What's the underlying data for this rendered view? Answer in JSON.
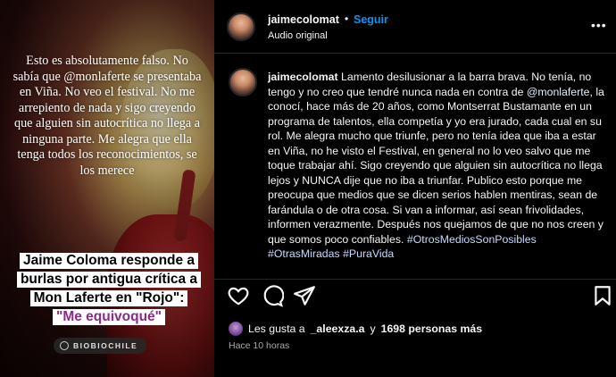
{
  "media": {
    "quote": "Esto es absolutamente falso. No sabía que @monlaferte se presentaba en Viña. No veo el festival. No me arrepiento de nada y sigo creyendo que alguien sin autocrítica no llega a ninguna parte. Me alegra que ella tenga todos los reconocimientos, se los merece",
    "headline_lines": [
      "Jaime Coloma responde a",
      "burlas por antigua crítica a",
      "Mon Laferte en \"Rojo\":"
    ],
    "headline_accent": "\"Me equivoqué\"",
    "brand": "BIOBIOCHILE"
  },
  "post": {
    "username": "jaimecolomat",
    "separator": "•",
    "follow_label": "Seguir",
    "audio": "Audio original",
    "more_label": "•••"
  },
  "comment": {
    "username": "jaimecolomat",
    "text_1": " Lamento desilusionar a la barra brava. No tenía, no tengo y no creo que tendré nunca nada en contra de ",
    "mention": "@monlaferte",
    "text_2": ", la conocí, hace más de 20 años, como Montserrat Bustamante en un programa de talentos, ella competía y yo era jurado, cada cual en su rol. Me alegra mucho que triunfe, pero no tenía idea que iba a estar en Viña, no he visto el Festival, en general no lo veo salvo que me toque trabajar ahí. Sigo creyendo que alguien sin autocrítica no llega lejos y NUNCA dije que no iba a triunfar. Publico esto porque me preocupa que medios que se dicen serios hablen mentiras, sean de farándula o de otra cosa. Si van a informar, así sean frivolidades, informen verazmente. Después nos quejamos de que no nos creen y que somos poco confiables.",
    "hashtags": [
      "#OtrosMediosSonPosibles",
      "#OtrasMiradas",
      "#PuraVida"
    ]
  },
  "actions": {
    "like_icon": "heart-icon",
    "comment_icon": "speech-bubble-icon",
    "share_icon": "paper-plane-icon",
    "save_icon": "bookmark-icon"
  },
  "likes": {
    "prefix": "Les gusta a",
    "user": "_aleexza.a",
    "connector": "y",
    "count": "1698 personas más"
  },
  "timestamp": "Hace 10 horas"
}
